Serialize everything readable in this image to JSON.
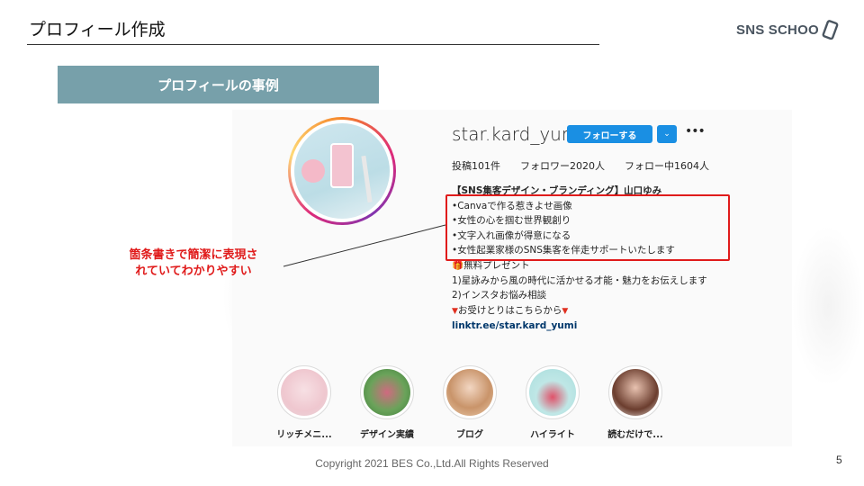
{
  "slide": {
    "title": "プロフィール作成",
    "section_label": "プロフィールの事例",
    "copyright": "Copyright 2021 BES Co.,Ltd.All Rights Reserved",
    "page_number": "5"
  },
  "logo": {
    "text": "SNS SCHOO",
    "icon": "phone-icon"
  },
  "profile": {
    "username": "star.kard_yumi",
    "follow_label": "フォローする",
    "dropdown_icon": "chevron-down-icon",
    "more_icon": "more-icon",
    "stats": {
      "posts": "投稿101件",
      "followers": "フォロワー2020人",
      "following": "フォロー中1604人"
    },
    "bio": {
      "name": "【SNS集客デザイン・ブランディング】山口ゆみ",
      "lines": [
        "•Canvaで作る惹きよせ画像",
        "•女性の心を掴む世界観創り",
        "•文字入れ画像が得意になる",
        "•女性起業家様のSNS集客を伴走サポートいたします"
      ],
      "gift_line": "無料プレゼント",
      "extra_lines": [
        "1)星詠みから風の時代に活かせる才能・魅力をお伝えします",
        "2)インスタお悩み相談"
      ],
      "receive_line": "お受けとりはこちらから",
      "link": "linktr.ee/star.kard_yumi"
    },
    "highlights": [
      {
        "label": "リッチメニ..."
      },
      {
        "label": "デザイン実績"
      },
      {
        "label": "ブログ"
      },
      {
        "label": "ハイライト"
      },
      {
        "label": "読むだけで..."
      }
    ]
  },
  "callout": {
    "line1": "箇条書きで簡潔に表現さ",
    "line2": "れていてわかりやすい"
  },
  "colors": {
    "accent_bar": "#77a0aa",
    "follow_button": "#1a8fe3",
    "highlight_red": "#e01b1b"
  }
}
